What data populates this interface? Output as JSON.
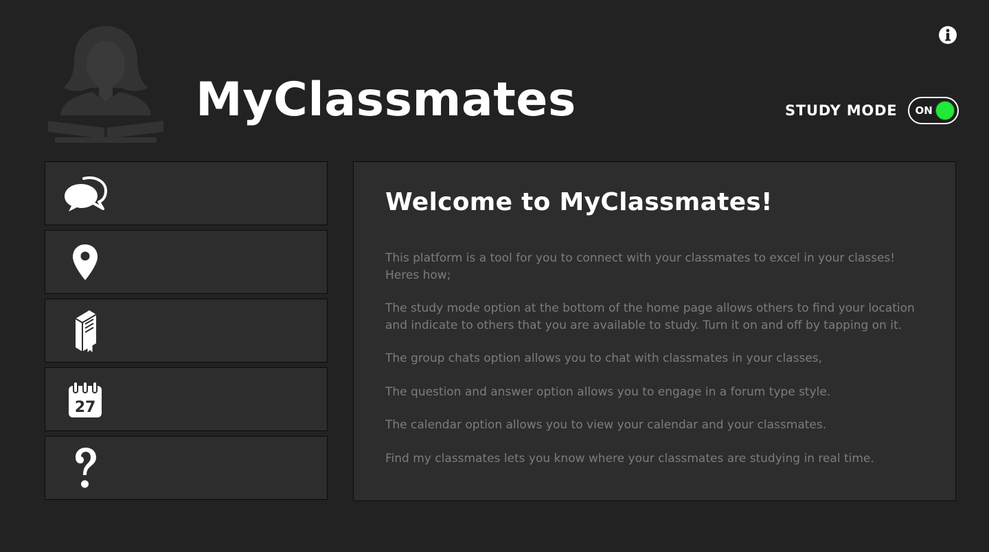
{
  "header": {
    "app_title": "MyClassmates",
    "study_mode_label": "STUDY MODE",
    "study_mode_toggle_text": "ON",
    "study_mode_on": true
  },
  "colors": {
    "background": "#222222",
    "panel": "#2d2d2d",
    "toggle_on": "#22e83a",
    "body_text": "#7c7c7c"
  },
  "sidebar": {
    "items": [
      {
        "icon": "chat-bubbles-icon"
      },
      {
        "icon": "map-pin-icon"
      },
      {
        "icon": "book-icon"
      },
      {
        "icon": "calendar-icon",
        "calendar_day": "27"
      },
      {
        "icon": "question-mark-icon"
      }
    ]
  },
  "welcome": {
    "title": "Welcome to MyClassmates!",
    "paragraphs": [
      "This platform is a tool for you to connect with your classmates to excel in your classes!\nHeres how;",
      "The study mode option at the bottom of the home page allows others to find your location\nand indicate to others that you are available to study. Turn it on and off by tapping on it.",
      "The group chats option allows you to chat with classmates in your classes,",
      "The question and answer option allows you to engage in a forum type style.",
      "The calendar option allows you to view your calendar and your classmates.",
      "Find my classmates lets you know  where your classmates are studying in real time."
    ]
  }
}
